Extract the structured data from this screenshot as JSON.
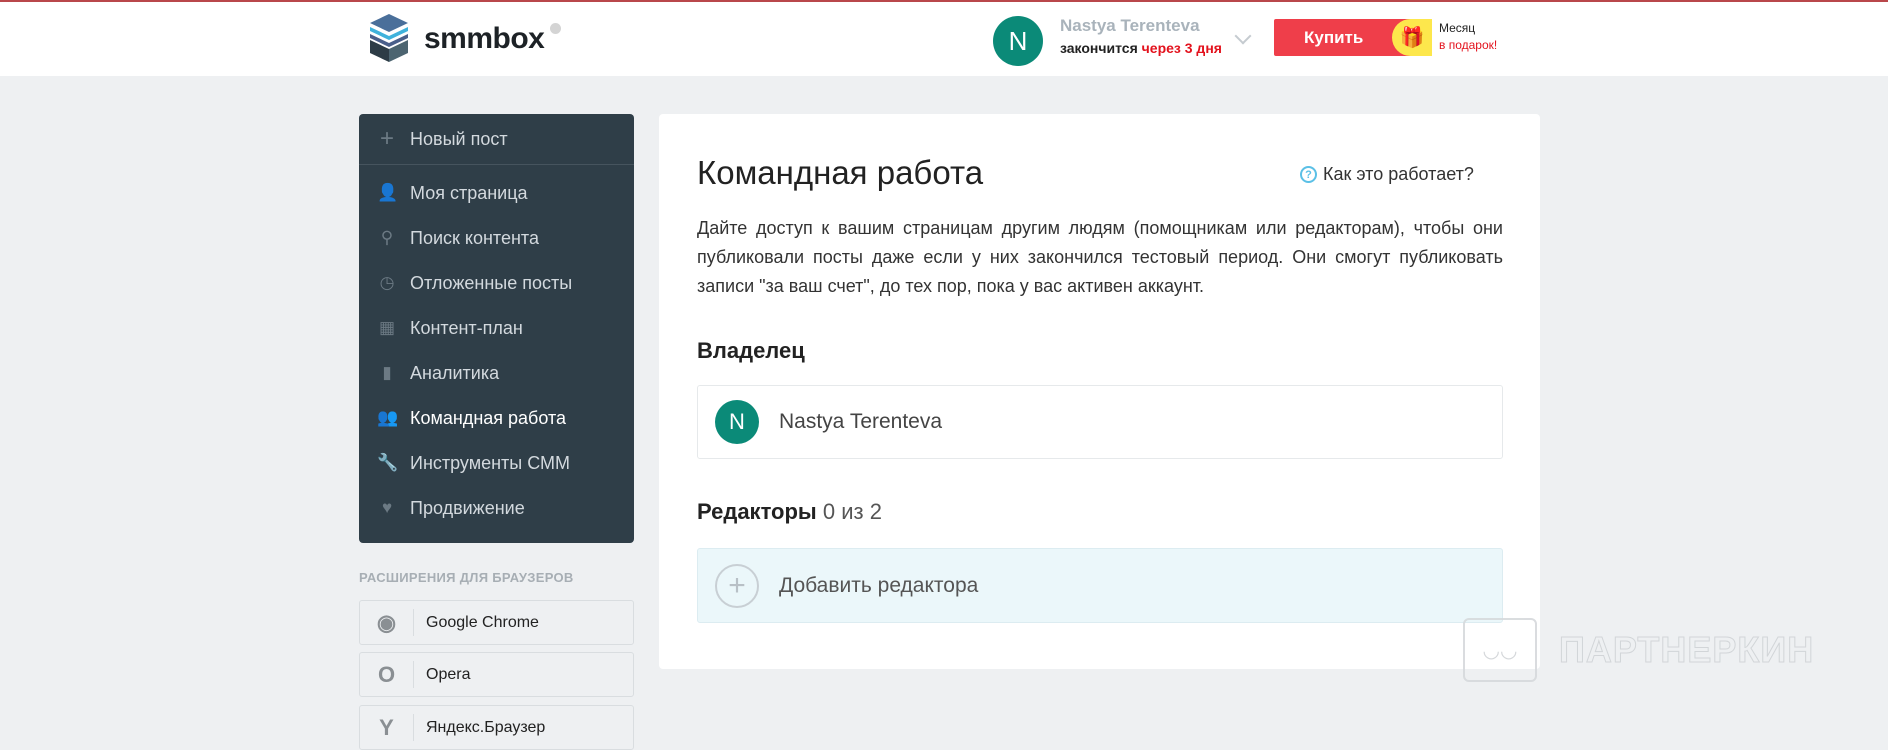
{
  "header": {
    "logo_text": "smmbox",
    "user_name": "Nastya Terenteva",
    "avatar_letter": "N",
    "expires_prefix": "закончится",
    "expires_value": "через 3 дня",
    "buy_label": "Купить",
    "promo_line1": "Месяц",
    "promo_line2": "в подарок!"
  },
  "sidebar": {
    "new_post": "Новый пост",
    "items": [
      {
        "label": "Моя страница",
        "icon": "user-icon"
      },
      {
        "label": "Поиск контента",
        "icon": "search-icon"
      },
      {
        "label": "Отложенные посты",
        "icon": "clock-icon"
      },
      {
        "label": "Контент-план",
        "icon": "calendar-icon"
      },
      {
        "label": "Аналитика",
        "icon": "bar-chart-icon"
      },
      {
        "label": "Командная работа",
        "icon": "team-icon",
        "active": true
      },
      {
        "label": "Инструменты СММ",
        "icon": "wrench-icon"
      },
      {
        "label": "Продвижение",
        "icon": "heart-icon"
      }
    ],
    "extensions_label": "РАСШИРЕНИЯ ДЛЯ БРАУЗЕРОВ",
    "extensions": [
      {
        "label": "Google Chrome",
        "icon": "chrome-icon"
      },
      {
        "label": "Opera",
        "icon": "opera-icon"
      },
      {
        "label": "Яндекс.Браузер",
        "icon": "yandex-browser-icon"
      }
    ]
  },
  "main": {
    "title": "Командная работа",
    "help_link": "Как это работает?",
    "description": "Дайте доступ к вашим страницам другим людям (помощникам или редакторам), чтобы они публиковали посты даже если у них закончился тестовый период. Они смогут публиковать записи \"за ваш счет\", до тех пор, пока у вас активен аккаунт.",
    "owner_heading": "Владелец",
    "owner_name": "Nastya Terenteva",
    "owner_avatar_letter": "N",
    "editors_heading": "Редакторы",
    "editors_count": "0 из 2",
    "add_editor": "Добавить редактора"
  },
  "watermark": "ПАРТНЕРКИН",
  "colors": {
    "accent_red": "#ef3e4a",
    "avatar_teal": "#0b8a78",
    "sidebar_bg": "#2f3e48"
  }
}
